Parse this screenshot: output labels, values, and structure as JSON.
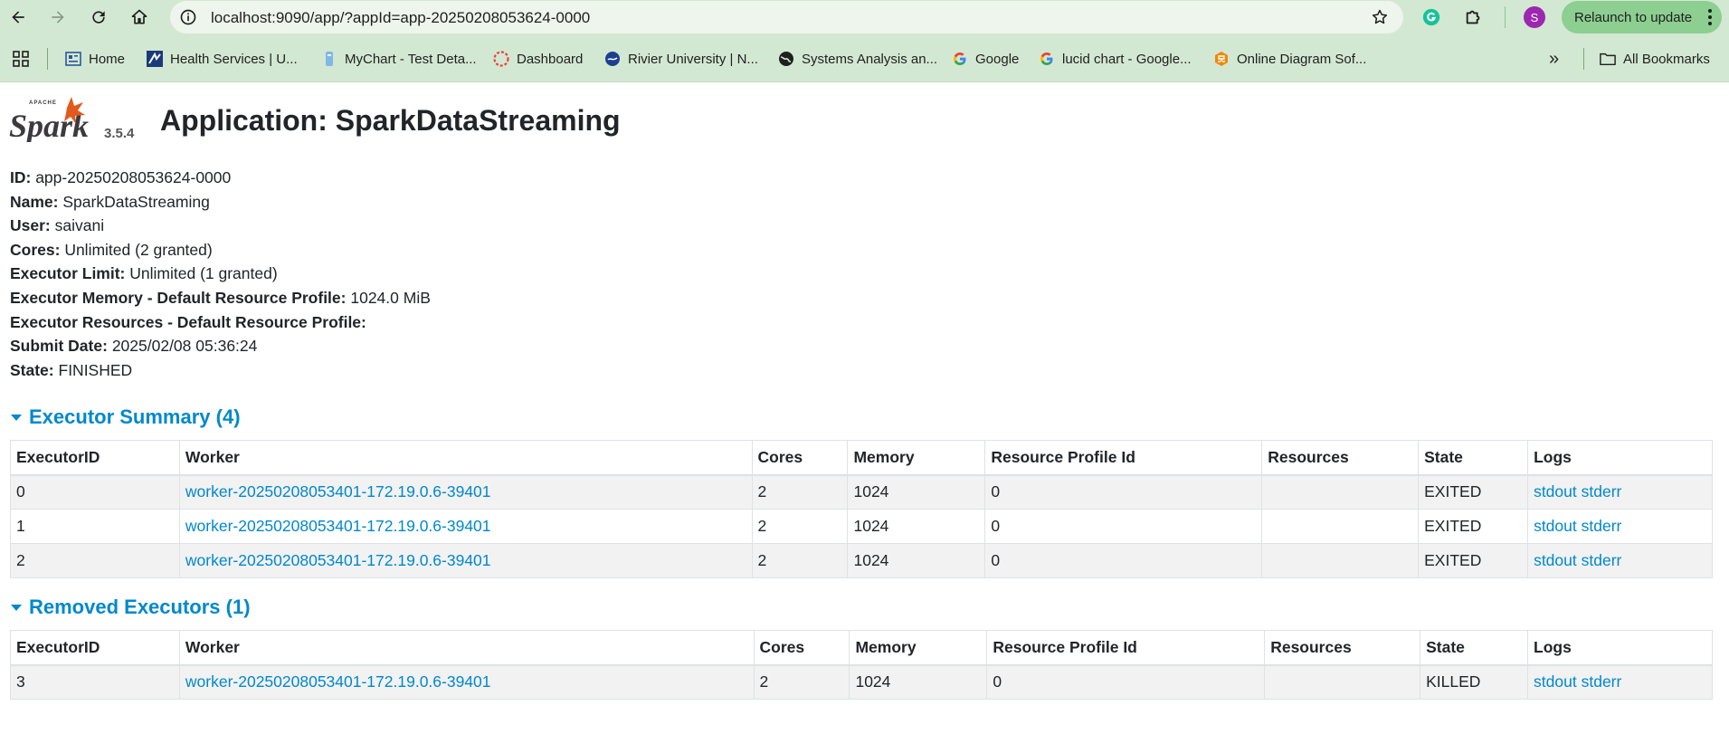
{
  "browser": {
    "url": "localhost:9090/app/?appId=app-20250208053624-0000",
    "avatar_initial": "S",
    "relaunch_label": "Relaunch to update",
    "bookmarks": [
      {
        "label": "Home",
        "icon": "home-bookmark-icon"
      },
      {
        "label": "Health Services | U...",
        "icon": "health-services-icon"
      },
      {
        "label": "MyChart - Test Deta...",
        "icon": "mychart-icon"
      },
      {
        "label": "Dashboard",
        "icon": "dashboard-icon"
      },
      {
        "label": "Rivier University | N...",
        "icon": "rivier-icon"
      },
      {
        "label": "Systems Analysis an...",
        "icon": "globe-icon"
      },
      {
        "label": "Google",
        "icon": "google-icon"
      },
      {
        "label": "lucid chart - Google...",
        "icon": "google-icon"
      },
      {
        "label": "Online Diagram Sof...",
        "icon": "drawio-icon"
      }
    ],
    "more_bookmarks": "»",
    "all_bookmarks_label": "All Bookmarks"
  },
  "header": {
    "version": "3.5.4",
    "title": "Application: SparkDataStreaming"
  },
  "info": [
    {
      "label": "ID:",
      "value": "app-20250208053624-0000"
    },
    {
      "label": "Name:",
      "value": "SparkDataStreaming"
    },
    {
      "label": "User:",
      "value": "saivani"
    },
    {
      "label": "Cores:",
      "value": "Unlimited (2 granted)"
    },
    {
      "label": "Executor Limit:",
      "value": "Unlimited (1 granted)"
    },
    {
      "label": "Executor Memory - Default Resource Profile:",
      "value": "1024.0 MiB"
    },
    {
      "label": "Executor Resources - Default Resource Profile:",
      "value": ""
    },
    {
      "label": "Submit Date:",
      "value": "2025/02/08 05:36:24"
    },
    {
      "label": "State:",
      "value": "FINISHED"
    }
  ],
  "columns": [
    "ExecutorID",
    "Worker",
    "Cores",
    "Memory",
    "Resource Profile Id",
    "Resources",
    "State",
    "Logs"
  ],
  "executor_summary": {
    "title": "Executor Summary (4)",
    "rows": [
      {
        "id": "0",
        "worker": "worker-20250208053401-172.19.0.6-39401",
        "cores": "2",
        "memory": "1024",
        "profile": "0",
        "resources": "",
        "state": "EXITED",
        "stdout": "stdout",
        "stderr": "stderr"
      },
      {
        "id": "1",
        "worker": "worker-20250208053401-172.19.0.6-39401",
        "cores": "2",
        "memory": "1024",
        "profile": "0",
        "resources": "",
        "state": "EXITED",
        "stdout": "stdout",
        "stderr": "stderr"
      },
      {
        "id": "2",
        "worker": "worker-20250208053401-172.19.0.6-39401",
        "cores": "2",
        "memory": "1024",
        "profile": "0",
        "resources": "",
        "state": "EXITED",
        "stdout": "stdout",
        "stderr": "stderr"
      }
    ]
  },
  "removed_executors": {
    "title": "Removed Executors (1)",
    "rows": [
      {
        "id": "3",
        "worker": "worker-20250208053401-172.19.0.6-39401",
        "cores": "2",
        "memory": "1024",
        "profile": "0",
        "resources": "",
        "state": "KILLED",
        "stdout": "stdout",
        "stderr": "stderr"
      }
    ]
  },
  "colors": {
    "link": "#0088cc",
    "chrome": "#d3e8d2",
    "relaunch": "#8ccf91"
  }
}
